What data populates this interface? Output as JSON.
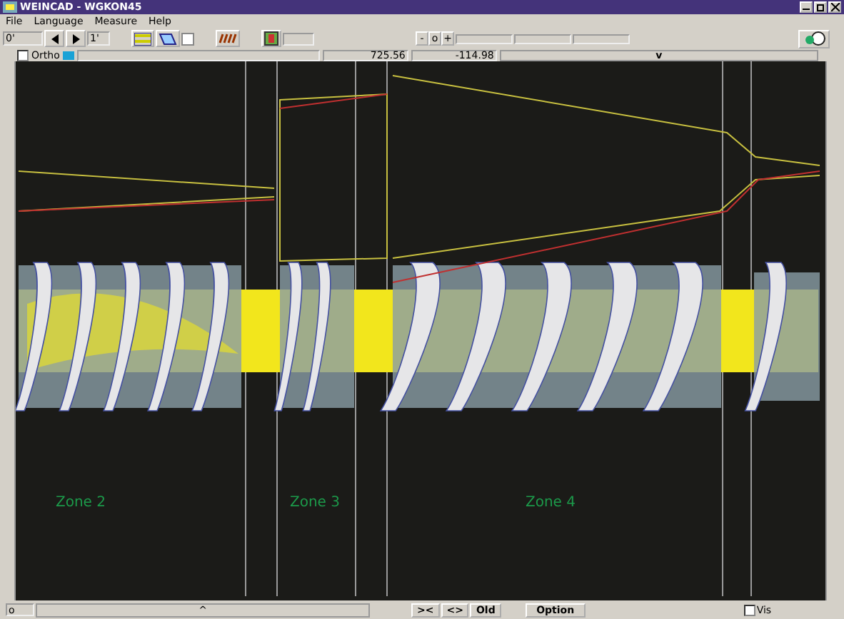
{
  "window": {
    "title": "WEINCAD - WGKON45"
  },
  "menu": [
    "File",
    "Language",
    "Measure",
    "Help"
  ],
  "toolbar": {
    "angle_start": "0'",
    "angle_end": "1'",
    "step_buttons": [
      "-",
      "o",
      "+"
    ]
  },
  "ortho": {
    "label": "Ortho",
    "checked": false
  },
  "readouts": [
    "725.56",
    "-114.98"
  ],
  "ruler_mark": "v",
  "zones": [
    {
      "label": "Zone 2"
    },
    {
      "label": "Zone 3"
    },
    {
      "label": "Zone 4"
    }
  ],
  "bottom": {
    "origin": "o",
    "scroll_mark": "^",
    "buttons": [
      "><",
      "<>",
      "Old"
    ],
    "option": "Option",
    "vis": {
      "label": "Vis",
      "checked": false
    }
  }
}
